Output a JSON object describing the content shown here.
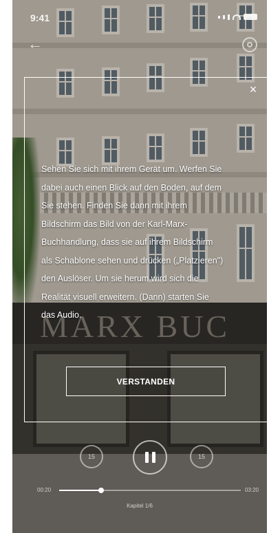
{
  "status_bar": {
    "time": "9:41"
  },
  "background": {
    "sign_text": "MARX BUC"
  },
  "dialog": {
    "close_glyph": "×",
    "lines": [
      "Sehen Sie sich mit ihrem Gerät um. Werfen Sie",
      "dabei auch einen Blick auf den Boden, auf dem",
      "Sie stehen. Finden Sie dann mit ihrem",
      "Bildschirm das Bild von der Karl-Marx-",
      "Buchhandlung, dass sie auf ihrem Bildschirm",
      "als Schablone sehen und drücken („Platzieren\")",
      "den Auslöser. Um sie herum wird sich die",
      "Realität visuell erweitern. (Dann) starten Sie",
      "das Audio."
    ],
    "confirm_label": "VERSTANDEN"
  },
  "player": {
    "time_elapsed": "00:20",
    "time_total": "03:20",
    "chapter": "Kapitel 1/6",
    "progress": 0.23,
    "rewind_label": "15",
    "forward_label": "15"
  },
  "icons": {
    "back": "back-arrow-icon",
    "settings": "settings-icon",
    "close": "close-icon",
    "pause": "pause-icon",
    "rewind": "rewind-15-icon",
    "forward": "forward-15-icon"
  }
}
